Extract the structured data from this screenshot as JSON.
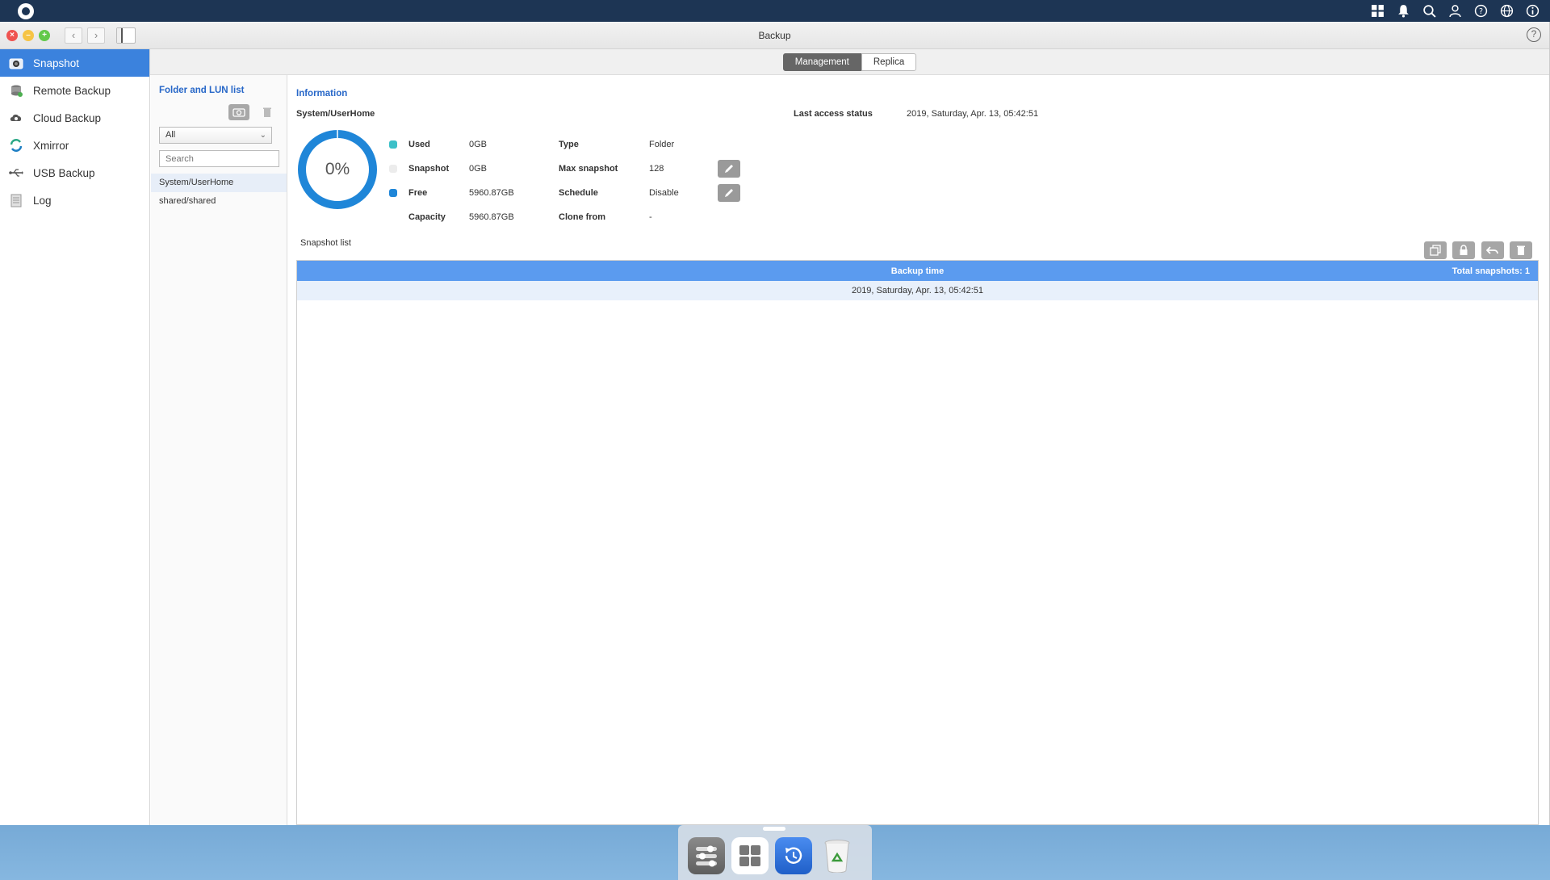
{
  "window": {
    "title": "Backup"
  },
  "sidebar": {
    "items": [
      {
        "label": "Snapshot",
        "icon": "camera-icon"
      },
      {
        "label": "Remote Backup",
        "icon": "remote-backup-icon"
      },
      {
        "label": "Cloud Backup",
        "icon": "cloud-backup-icon"
      },
      {
        "label": "Xmirror",
        "icon": "sync-icon"
      },
      {
        "label": "USB Backup",
        "icon": "usb-icon"
      },
      {
        "label": "Log",
        "icon": "log-icon"
      }
    ]
  },
  "tabs": [
    "Management",
    "Replica"
  ],
  "folders": {
    "title": "Folder and LUN list",
    "filter_value": "All",
    "search_placeholder": "Search",
    "items": [
      "System/UserHome",
      "shared/shared"
    ]
  },
  "info": {
    "heading": "Information",
    "folder_name": "System/UserHome",
    "last_access_label": "Last access status",
    "last_access_value": "2019, Saturday, Apr. 13, 05:42:51",
    "usage_percent": "0%",
    "usage_fraction": 0,
    "used_label": "Used",
    "used_value": "0GB",
    "snapshot_label": "Snapshot",
    "snapshot_value": "0GB",
    "free_label": "Free",
    "free_value": "5960.87GB",
    "capacity_label": "Capacity",
    "capacity_value": "5960.87GB",
    "type_label": "Type",
    "type_value": "Folder",
    "max_snapshot_label": "Max snapshot",
    "max_snapshot_value": "128",
    "schedule_label": "Schedule",
    "schedule_value": "Disable",
    "clone_from_label": "Clone from",
    "clone_from_value": "-"
  },
  "snapshot_list": {
    "title": "Snapshot list",
    "column_header": "Backup time",
    "total": "Total snapshots: 1",
    "rows": [
      "2019, Saturday, Apr. 13, 05:42:51"
    ]
  },
  "colors": {
    "accent": "#3b82dd",
    "used": "#3cc0c8",
    "free": "#1f86d8",
    "table_header": "#5b9bef"
  }
}
